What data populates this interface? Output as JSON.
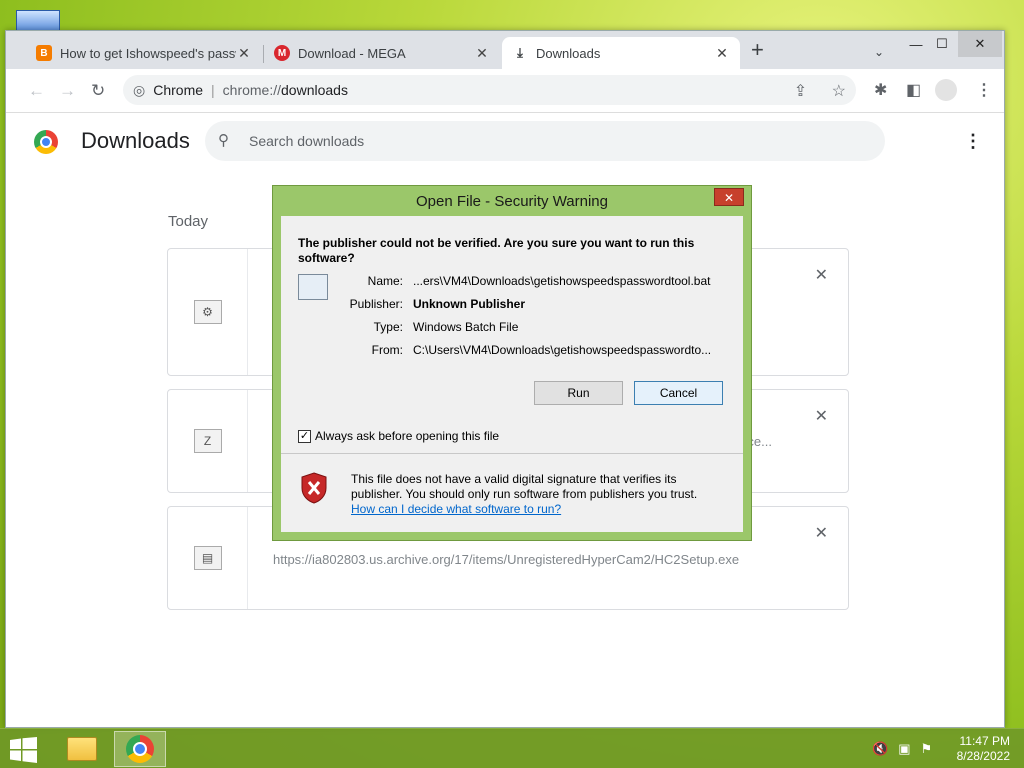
{
  "browser": {
    "tabs": [
      {
        "title": "How to get Ishowspeed's password",
        "favicon": "blogger-icon",
        "color": "#f57c00"
      },
      {
        "title": "Download - MEGA",
        "favicon": "mega-icon",
        "color": "#d9272e"
      },
      {
        "title": "Downloads",
        "favicon": "download-icon"
      }
    ],
    "new_tab": "+",
    "omnibox": {
      "site": "Chrome",
      "url_prefix": "chrome://",
      "url_path": "downloads"
    }
  },
  "downloads_page": {
    "title": "Downloads",
    "search_placeholder": "Search downloads",
    "section_today": "Today",
    "items": [
      {
        "icon": "batch-file-icon",
        "url": ""
      },
      {
        "icon": "zip-file-icon",
        "url": "",
        "trail": "ce..."
      },
      {
        "icon": "exe-file-icon",
        "url": "https://ia802803.us.archive.org/17/items/UnregisteredHyperCam2/HC2Setup.exe"
      }
    ]
  },
  "dialog": {
    "title": "Open File - Security Warning",
    "question": "The publisher could not be verified.  Are you sure you want to run this software?",
    "fields": [
      {
        "label": "Name:",
        "value": "...ers\\VM4\\Downloads\\getishowspeedspasswordtool.bat"
      },
      {
        "label": "Publisher:",
        "value": "Unknown Publisher"
      },
      {
        "label": "Type:",
        "value": "Windows Batch File"
      },
      {
        "label": "From:",
        "value": "C:\\Users\\VM4\\Downloads\\getishowspeedspasswordto..."
      }
    ],
    "run_label": "Run",
    "cancel_label": "Cancel",
    "checkbox_label": "Always ask before opening this file",
    "checkbox_checked": true,
    "warning_text": "This file does not have a valid digital signature that verifies its publisher.  You should only run software from publishers you trust.",
    "link_text": "How can I decide what software to run?"
  },
  "taskbar": {
    "time": "11:47 PM",
    "date": "8/28/2022"
  }
}
